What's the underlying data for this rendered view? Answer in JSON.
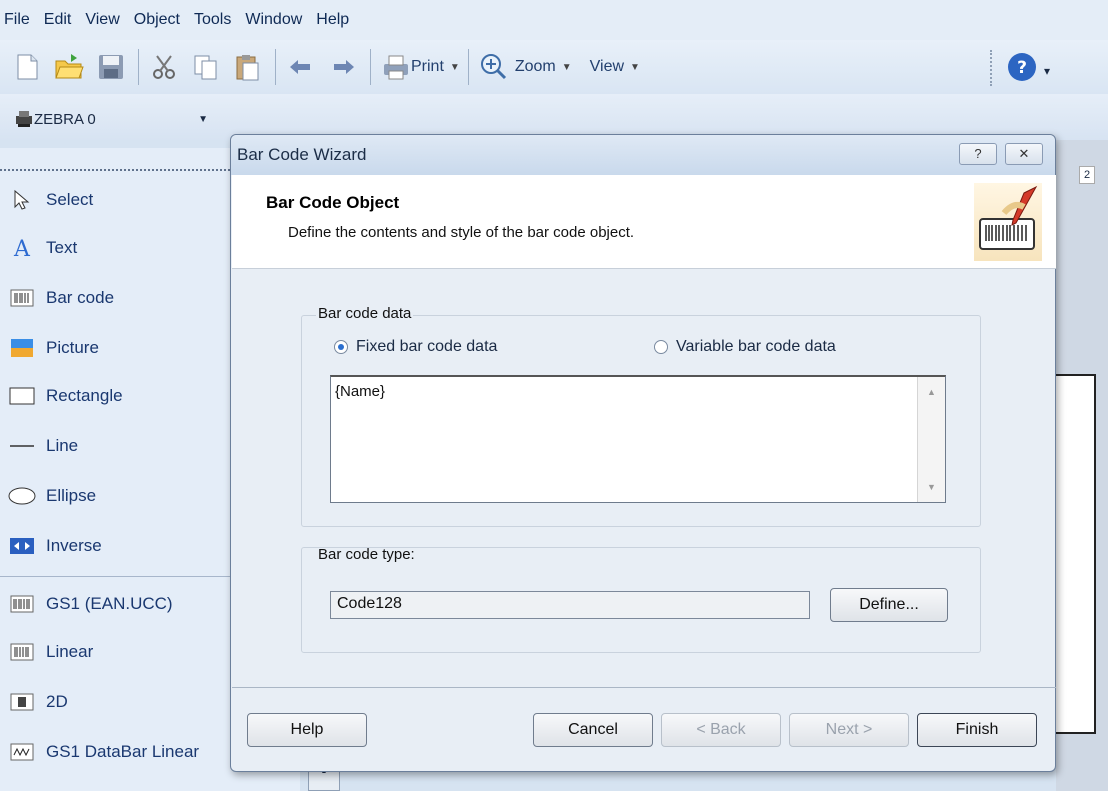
{
  "menu": [
    {
      "label": "File"
    },
    {
      "label": "Edit"
    },
    {
      "label": "View"
    },
    {
      "label": "Object"
    },
    {
      "label": "Tools"
    },
    {
      "label": "Window"
    },
    {
      "label": "Help"
    }
  ],
  "toolbar": {
    "print_label": "Print",
    "zoom_label": "Zoom",
    "view_label": "View"
  },
  "format_toolbar": {
    "printer": "ZEBRA 0"
  },
  "tools": [
    {
      "label": "Select",
      "icon": "cursor-icon"
    },
    {
      "label": "Text",
      "icon": "text-a-icon"
    },
    {
      "label": "Bar code",
      "icon": "barcode-icon"
    },
    {
      "label": "Picture",
      "icon": "picture-icon"
    },
    {
      "label": "Rectangle",
      "icon": "rectangle-icon"
    },
    {
      "label": "Line",
      "icon": "line-icon"
    },
    {
      "label": "Ellipse",
      "icon": "ellipse-icon"
    },
    {
      "label": "Inverse",
      "icon": "inverse-icon"
    },
    {
      "label": "GS1 (EAN.UCC)",
      "icon": "gs1-barcode-icon"
    },
    {
      "label": "Linear",
      "icon": "linear-barcode-icon"
    },
    {
      "label": "2D",
      "icon": "2d-barcode-icon"
    },
    {
      "label": "GS1 DataBar Linear",
      "icon": "databar-icon"
    }
  ],
  "ruler": {
    "number": "2"
  },
  "dialog": {
    "title": "Bar Code Wizard",
    "help_caption": "?",
    "close_caption": "✕",
    "header_title": "Bar Code Object",
    "header_subtitle": "Define the contents and style of the bar code object.",
    "data_group_label": "Bar code data",
    "radio_fixed": "Fixed bar code data",
    "radio_variable": "Variable bar code data",
    "selected_option": "fixed",
    "data_value": "{Name}",
    "type_group_label": "Bar code type:",
    "type_value": "Code128",
    "define_button": "Define...",
    "help_button": "Help",
    "cancel_button": "Cancel",
    "back_button": "< Back",
    "next_button": "Next >",
    "finish_button": "Finish"
  }
}
